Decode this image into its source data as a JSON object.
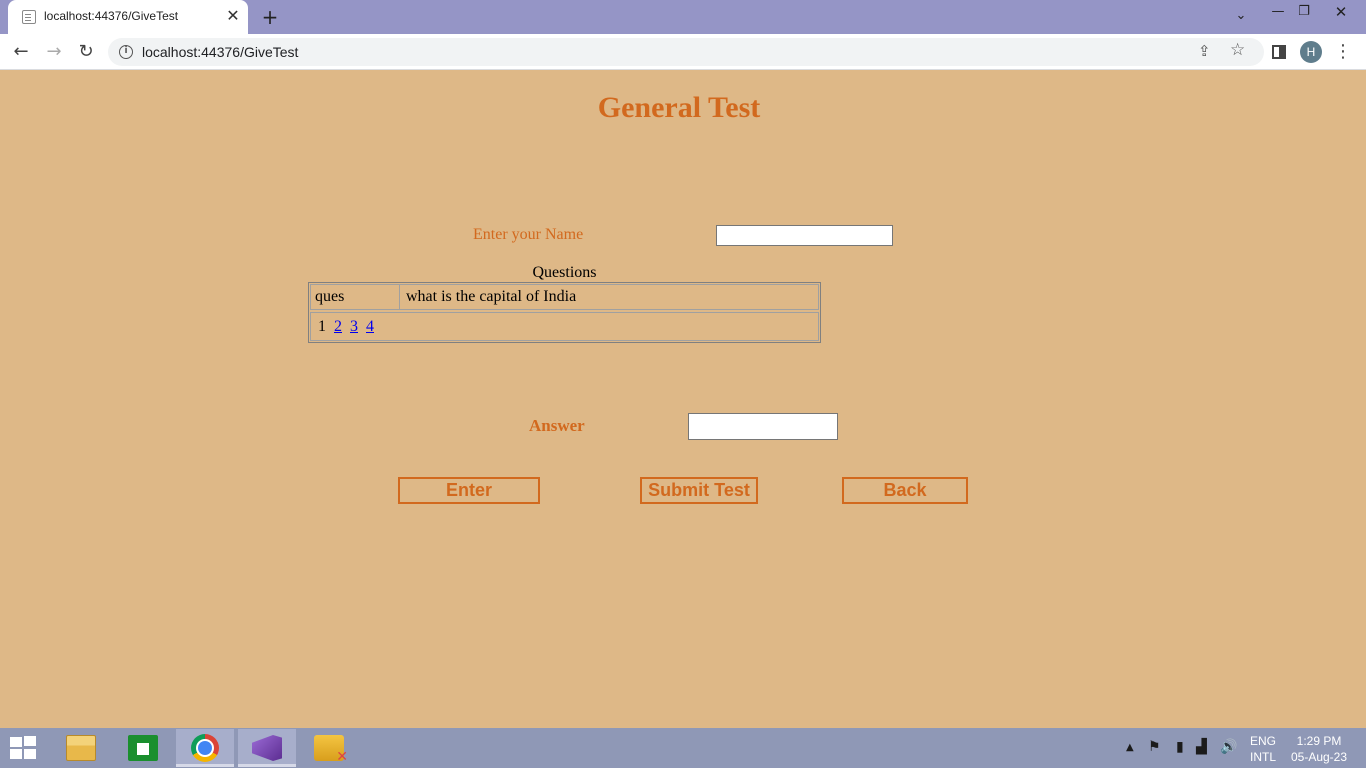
{
  "browser": {
    "tab_title": "localhost:44376/GiveTest",
    "tab_close": "✕",
    "new_tab": "+",
    "url": "localhost:44376/GiveTest",
    "avatar_initial": "H",
    "window": {
      "dropdown": "⌄",
      "minimize": "—",
      "restore": "❐",
      "close": "✕"
    },
    "nav": {
      "back": "←",
      "forward": "→",
      "reload": "↻",
      "menu": "⋮",
      "share": "⇪",
      "star": "☆",
      "info": "i"
    }
  },
  "page": {
    "heading": "General Test",
    "name_label": "Enter your Name",
    "name_value": "",
    "questions_caption": "Questions",
    "question": {
      "key": "ques",
      "text": "what is the capital of India"
    },
    "pager": {
      "current": "1",
      "links": [
        "2",
        "3",
        "4"
      ]
    },
    "answer_label": "Answer",
    "answer_value": "",
    "buttons": {
      "enter": "Enter",
      "submit": "Submit Test",
      "back": "Back"
    },
    "colors": {
      "background": "#deb887",
      "accent": "#d2691e"
    }
  },
  "taskbar": {
    "apps": [
      {
        "name": "file-explorer-icon",
        "active": false
      },
      {
        "name": "store-icon",
        "active": false
      },
      {
        "name": "chrome-icon",
        "active": true
      },
      {
        "name": "visual-studio-icon",
        "active": true
      },
      {
        "name": "database-tool-icon",
        "active": false
      }
    ],
    "language": {
      "line1": "ENG",
      "line2": "INTL"
    },
    "clock": {
      "time": "1:29 PM",
      "date": "05-Aug-23"
    }
  }
}
